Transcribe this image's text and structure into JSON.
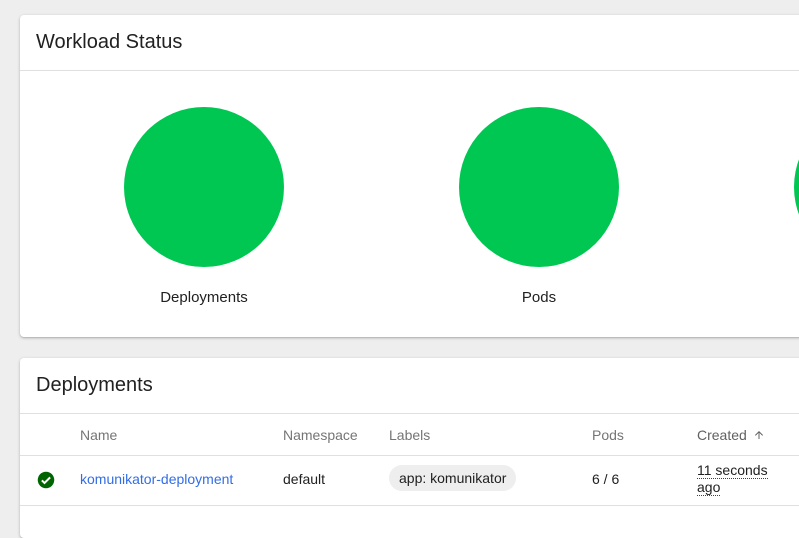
{
  "colors": {
    "chart_success": "#00c752",
    "link": "#326de6",
    "status_ok": "#006400"
  },
  "workload_status": {
    "title": "Workload Status",
    "charts": [
      {
        "label": "Deployments",
        "status": "running",
        "running_fraction": 1.0
      },
      {
        "label": "Pods",
        "status": "running",
        "running_fraction": 1.0
      }
    ]
  },
  "deployments": {
    "title": "Deployments",
    "columns": {
      "name": "Name",
      "namespace": "Namespace",
      "labels": "Labels",
      "pods": "Pods",
      "created": "Created",
      "sort_icon": "arrow-upward-icon"
    },
    "rows": [
      {
        "status_icon": "check-circle-icon",
        "name": "komunikator-deployment",
        "namespace": "default",
        "label": "app: komunikator",
        "pods": "6 / 6",
        "created_line1": "11 seconds",
        "created_line2": "ago"
      }
    ]
  }
}
